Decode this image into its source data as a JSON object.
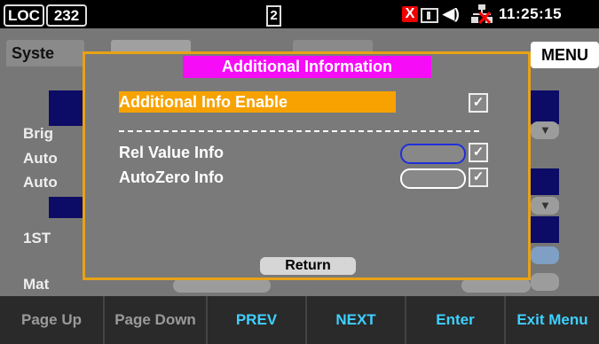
{
  "status": {
    "mode": "LOC",
    "number": "232",
    "tab_indicator": "2",
    "time": "11:25:15",
    "icons": [
      "error-x-icon",
      "memory-icon",
      "speaker-icon",
      "lan-disconnected-icon"
    ],
    "error_mark": "X"
  },
  "background": {
    "tab_label": "Syste",
    "menu_label": "MENU",
    "labels": [
      "Brig",
      "Auto",
      "Auto",
      "1ST",
      "Mat"
    ]
  },
  "dialog": {
    "title": "Additional Information",
    "enable_label": "Additional Info Enable",
    "enable_checked": true,
    "items": [
      {
        "label": "Rel Value Info",
        "checked": true,
        "oval": "blue"
      },
      {
        "label": "AutoZero Info",
        "checked": true,
        "oval": "white"
      }
    ],
    "return_label": "Return"
  },
  "softkeys": [
    {
      "label": "Page Up",
      "state": "dim"
    },
    {
      "label": "Page Down",
      "state": "dim"
    },
    {
      "label": "PREV",
      "state": "on"
    },
    {
      "label": "NEXT",
      "state": "on"
    },
    {
      "label": "Enter",
      "state": "on"
    },
    {
      "label": "Exit Menu",
      "state": "on"
    }
  ],
  "colors": {
    "accent_title": "#f70cf7",
    "highlight_row": "#f7a200",
    "dialog_border": "#e8a216",
    "softkey_active": "#3fd0ff"
  }
}
